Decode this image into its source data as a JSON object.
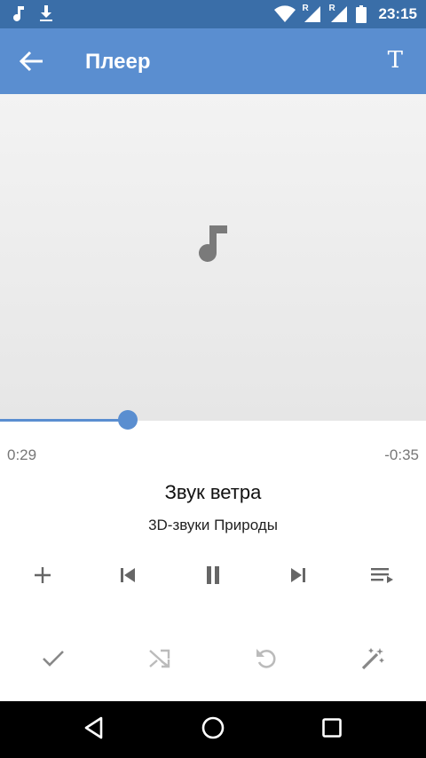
{
  "status_bar": {
    "time": "23:15",
    "icons": [
      "music-note-icon",
      "download-icon",
      "wifi-icon",
      "signal-r-icon",
      "signal-r-icon",
      "battery-icon"
    ],
    "roaming_mark": "R"
  },
  "app_bar": {
    "title": "Плеер",
    "text_button": "T",
    "back_icon": "arrow-back-icon"
  },
  "artwork": {
    "placeholder_icon": "music-note-icon"
  },
  "progress": {
    "fraction": 0.3,
    "elapsed": "0:29",
    "remaining": "-0:35"
  },
  "track": {
    "title": "Звук ветра",
    "artist": "3D-звуки Природы"
  },
  "controls": [
    "add-icon",
    "skip-previous-icon",
    "pause-icon",
    "skip-next-icon",
    "playlist-icon"
  ],
  "secondary_controls": [
    "check-icon",
    "shuffle-icon",
    "repeat-icon",
    "magic-wand-icon"
  ],
  "colors": {
    "status_bar": "#3a6ea8",
    "app_bar": "#5a8ed0",
    "accent": "#5a8ed0"
  }
}
